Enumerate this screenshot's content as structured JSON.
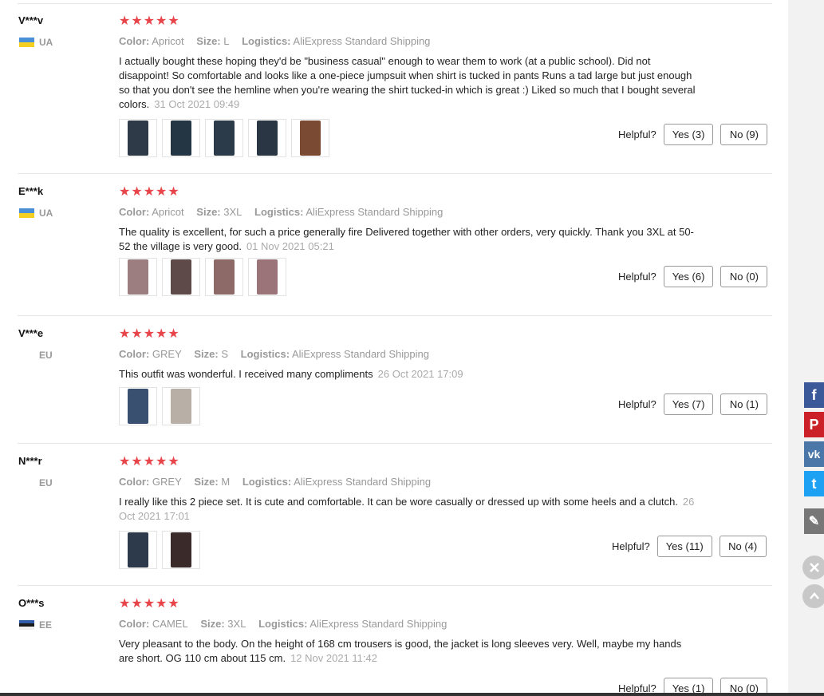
{
  "reviews": [
    {
      "user": "V***v",
      "country": "UA",
      "flag": "ua",
      "stars": "★★★★★",
      "attrs": [
        {
          "key": "Color:",
          "value": "Apricot"
        },
        {
          "key": "Size:",
          "value": "L"
        },
        {
          "key": "Logistics:",
          "value": "AliExpress Standard Shipping"
        }
      ],
      "text": "I actually bought these hoping they'd be \"business casual\" enough to wear them to work (at a public school). Did not disappoint! So comfortable and looks like a one-piece jumpsuit when shirt is tucked in pants Runs a tad large but just enough so that you don't see the hemline when you're wearing the shirt tucked-in which is great :) Liked so much that I bought several colors.",
      "date": "31 Oct 2021 09:49",
      "helpful_label": "Helpful?",
      "yes": "Yes (3)",
      "no": "No (9)",
      "photo_colors": [
        "#2f3a48",
        "#243544",
        "#2c3b4a",
        "#2a3644",
        "#7a4a32"
      ]
    },
    {
      "user": "E***k",
      "country": "UA",
      "flag": "ua",
      "stars": "★★★★★",
      "attrs": [
        {
          "key": "Color:",
          "value": "Apricot"
        },
        {
          "key": "Size:",
          "value": "3XL"
        },
        {
          "key": "Logistics:",
          "value": "AliExpress Standard Shipping"
        }
      ],
      "text": "The quality is excellent, for such a price generally fire Delivered together with other orders, very quickly. Thank you 3XL at 50-52 the village is very good.",
      "date": "01 Nov 2021 05:21",
      "helpful_label": "Helpful?",
      "yes": "Yes (6)",
      "no": "No (0)",
      "photo_colors": [
        "#9c7d80",
        "#5e4a48",
        "#8d6a68",
        "#9a7478"
      ]
    },
    {
      "user": "V***e",
      "country": "EU",
      "flag": "none",
      "stars": "★★★★★",
      "attrs": [
        {
          "key": "Color:",
          "value": "GREY"
        },
        {
          "key": "Size:",
          "value": "S"
        },
        {
          "key": "Logistics:",
          "value": "AliExpress Standard Shipping"
        }
      ],
      "text": "This outfit was wonderful. I received many compliments",
      "date": "26 Oct 2021 17:09",
      "helpful_label": "Helpful?",
      "yes": "Yes (7)",
      "no": "No (1)",
      "photo_colors": [
        "#3a5070",
        "#b8b0a6"
      ]
    },
    {
      "user": "N***r",
      "country": "EU",
      "flag": "none",
      "stars": "★★★★★",
      "attrs": [
        {
          "key": "Color:",
          "value": "GREY"
        },
        {
          "key": "Size:",
          "value": "M"
        },
        {
          "key": "Logistics:",
          "value": "AliExpress Standard Shipping"
        }
      ],
      "text": "I really like this 2 piece set. It is cute and comfortable. It can be wore casually or dressed up with some heels and a clutch.",
      "date": "26 Oct 2021 17:01",
      "helpful_label": "Helpful?",
      "yes": "Yes (11)",
      "no": "No (4)",
      "photo_colors": [
        "#2d3a4c",
        "#3a2a2a"
      ]
    },
    {
      "user": "O***s",
      "country": "EE",
      "flag": "ee",
      "stars": "★★★★★",
      "attrs": [
        {
          "key": "Color:",
          "value": "CAMEL"
        },
        {
          "key": "Size:",
          "value": "3XL"
        },
        {
          "key": "Logistics:",
          "value": "AliExpress Standard Shipping"
        }
      ],
      "text": "Very pleasant to the body. On the height of 168 cm trousers is good, the jacket is long sleeves very. Well, maybe my hands are short. OG 110 cm about 115 cm.",
      "date": "12 Nov 2021 11:42",
      "helpful_label": "Helpful?",
      "yes": "Yes (1)",
      "no": "No (0)",
      "photo_colors": []
    }
  ],
  "share": [
    {
      "icon": "facebook-icon",
      "glyph": "f",
      "color": "#3b5998"
    },
    {
      "icon": "pinterest-icon",
      "glyph": "P",
      "color": "#cb2027"
    },
    {
      "icon": "vk-icon",
      "glyph": "vk",
      "color": "#4a76a8"
    },
    {
      "icon": "twitter-icon",
      "glyph": "t",
      "color": "#1da1f2"
    },
    {
      "icon": "edit-icon",
      "glyph": "✎",
      "color": "#777777"
    }
  ]
}
